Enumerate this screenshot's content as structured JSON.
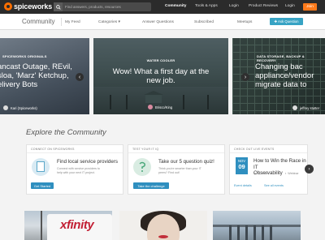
{
  "brand": {
    "name": "spiceworks",
    "accent": "#ff7a1a"
  },
  "topnav": {
    "search_placeholder": "Find answers, products, resources",
    "links": [
      "Community",
      "Tools & Apps",
      "Login",
      "Product Reviews",
      "Login"
    ],
    "join_label": "Join"
  },
  "subnav": {
    "title": "Community",
    "links": [
      "My Feed",
      "Categories",
      "Answer Questions",
      "Subscribed",
      "Meetups"
    ],
    "ask_label": "Ask Question"
  },
  "carousel": {
    "left": {
      "tag": "SPICEWORKS ORIGINALS",
      "title_lines": [
        "ancast Outage, REvil,",
        "sloa, 'Marz' Ketchup,",
        "elivery Bots"
      ],
      "author": "Kari (Spiceworks)"
    },
    "center": {
      "tag": "WATER COOLER",
      "title_lines": [
        "Wow! What a first day at the",
        "new job."
      ],
      "author": "Brisco/King"
    },
    "right": {
      "tag": "DATA STORAGE, BACKUP & RECOVERY",
      "title_lines": [
        "Changing bac",
        "appliance/vendor",
        "migrate data to"
      ],
      "author": "jeffrey stutter"
    },
    "prev_icon": "chevron-left-icon",
    "next_icon": "chevron-right-icon"
  },
  "explore": {
    "heading": "Explore the Community",
    "cards": [
      {
        "header": "CONNECT ON SPICEWORKS",
        "title_lines": [
          "Find local service providers"
        ],
        "text_lines": [
          "Connect with service providers to",
          "help with your next IT project."
        ],
        "button": "Get Started",
        "icon": "document-icon"
      },
      {
        "header": "TEST YOUR IT IQ",
        "title_lines": [
          "Take our 5 question quiz!"
        ],
        "text_lines": [
          "Think you're smarter than your IT",
          "peers? Find out!"
        ],
        "button": "Take the challenge",
        "icon": "quiz-icon"
      },
      {
        "header": "CHECK OUT LIVE EVENTS",
        "month": "NOV",
        "day": "09",
        "title_lines": [
          "How to Win the Race in IT",
          "Observability"
        ],
        "time": "11:00am",
        "type": "Webinar",
        "links": [
          "Event details",
          "See all events"
        ]
      }
    ]
  },
  "thumbs": {
    "xfinity_text": "xfinity"
  }
}
